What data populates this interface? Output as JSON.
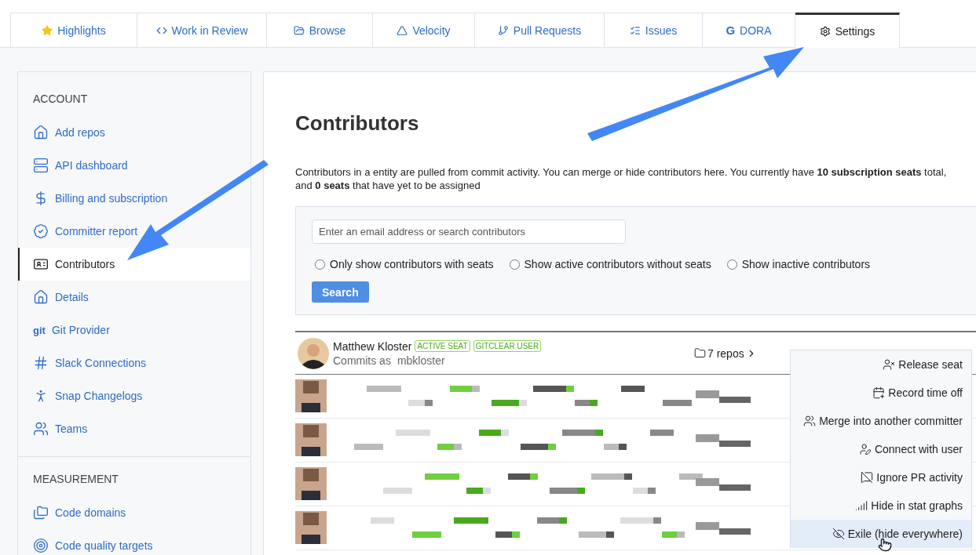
{
  "tabs": [
    {
      "label": "Highlights",
      "selected": false
    },
    {
      "label": "Work in Review",
      "selected": false
    },
    {
      "label": "Browse",
      "selected": false
    },
    {
      "label": "Velocity",
      "selected": false
    },
    {
      "label": "Pull Requests",
      "selected": false
    },
    {
      "label": "Issues",
      "selected": false
    },
    {
      "label": "DORA",
      "glyph": "G",
      "selected": false
    },
    {
      "label": "Settings",
      "selected": true
    }
  ],
  "sidebar": {
    "sections": [
      {
        "heading": "ACCOUNT",
        "items": [
          {
            "label": "Add repos",
            "selected": false
          },
          {
            "label": "API dashboard",
            "selected": false
          },
          {
            "label": "Billing and subscription",
            "selected": false
          },
          {
            "label": "Committer report",
            "selected": false
          },
          {
            "label": "Contributors",
            "selected": true
          },
          {
            "label": "Details",
            "selected": false
          },
          {
            "label": "Git Provider",
            "glyph": "git",
            "selected": false
          },
          {
            "label": "Slack Connections",
            "selected": false
          },
          {
            "label": "Snap Changelogs",
            "selected": false
          },
          {
            "label": "Teams",
            "selected": false
          }
        ]
      },
      {
        "heading": "MEASUREMENT",
        "items": [
          {
            "label": "Code domains",
            "selected": false
          },
          {
            "label": "Code quality targets",
            "selected": false
          }
        ]
      }
    ]
  },
  "main": {
    "title": "Contributors",
    "description": "Contributors in a entity are pulled from commit activity. You can merge or hide contributors here. You currently have **10 subscription seats** total, and **0 seats** that have yet to be assigned",
    "search": {
      "placeholder": "Enter an email address or search contributors",
      "filters": [
        {
          "label": "Only show contributors with seats",
          "checked": false
        },
        {
          "label": "Show active contributors without seats",
          "checked": false
        },
        {
          "label": "Show inactive contributors",
          "checked": false
        }
      ],
      "button": "Search"
    },
    "contributor": {
      "name": "Matthew Kloster",
      "badges": [
        "ACTIVE SEAT",
        "GITCLEAR USER"
      ],
      "commits_as": "Commits as",
      "handle": "mbkloster",
      "repos": "7 repos"
    }
  },
  "menu": {
    "items": [
      {
        "label": "Release seat",
        "selected": false
      },
      {
        "label": "Record time off",
        "selected": false
      },
      {
        "label": "Merge into another committer",
        "selected": false
      },
      {
        "label": "Connect with user",
        "selected": false
      },
      {
        "label": "Ignore PR activity",
        "selected": false
      },
      {
        "label": "Hide in stat graphs",
        "selected": false
      },
      {
        "label": "Exile (hide everywhere)",
        "selected": true
      }
    ]
  }
}
